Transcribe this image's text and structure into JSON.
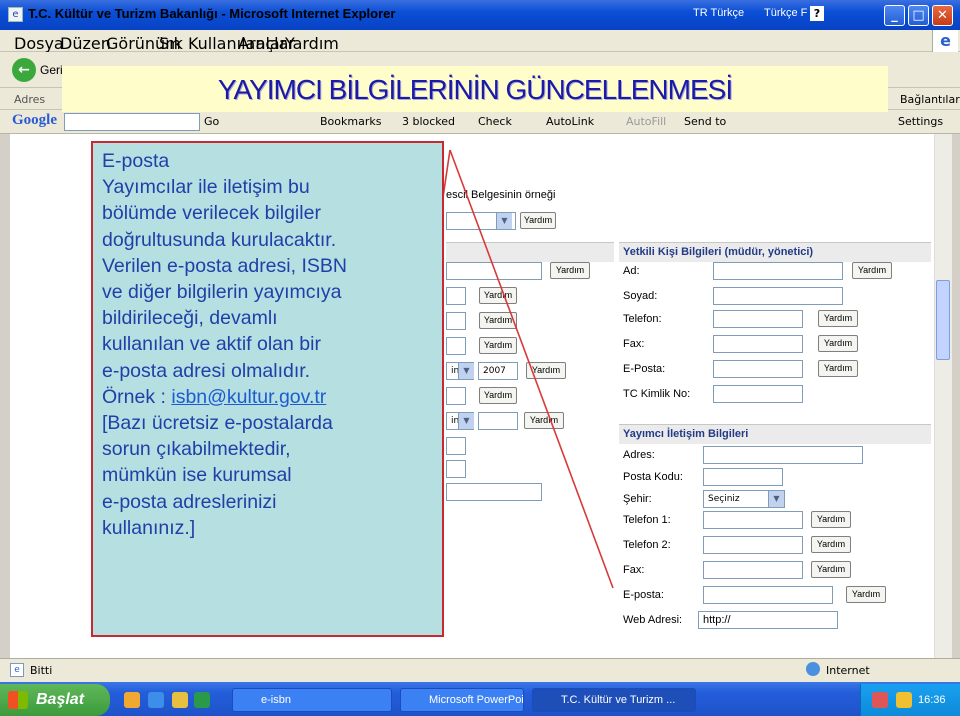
{
  "window": {
    "title": "T.C. Kültür ve Turizm Bakanlığı - Microsoft Internet Explorer",
    "lang1": "TR Türkçe",
    "lang2": "Türkçe F"
  },
  "menu": [
    "Dosya",
    "Düzen",
    "Görünüm",
    "Sık Kullanılanlar",
    "Araçlar",
    "Yardım"
  ],
  "toolbar": {
    "back": "Geri",
    "address_label": "Adres",
    "links_label": "Bağlantılar"
  },
  "google_toolbar": {
    "logo": "Google",
    "go": "Go",
    "bookmarks": "Bookmarks",
    "blocked": "3 blocked",
    "check": "Check",
    "autolink": "AutoLink",
    "autofill": "AutoFill",
    "sendto": "Send to",
    "settings": "Settings"
  },
  "slide": {
    "title": "YAYIMCI BİLGİLERİNİN GÜNCELLENMESİ",
    "lines": [
      "E-posta",
      "Yayımcılar ile iletişim bu",
      "bölümde verilecek bilgiler",
      "doğrultusunda kurulacaktır.",
      "Verilen e-posta adresi, ISBN",
      "ve diğer bilgilerin yayımcıya",
      "bildirileceği, devamlı",
      "kullanılan ve aktif olan bir",
      "e-posta adresi olmalıdır.",
      "Örnek : ",
      "[Bazı ücretsiz e-postalarda",
      "sorun çıkabilmektedir,",
      "mümkün ise kurumsal",
      "e-posta adreslerinizi",
      "kullanınız.]"
    ],
    "example_email": "isbn@kultur.gov.tr"
  },
  "form": {
    "tescil_label": "escil Belgesinin örneği",
    "yardim": "Yardım",
    "year_value": "2007",
    "niz": "iniz",
    "yetkili_header": "Yetkili Kişi Bilgileri (müdür, yönetici)",
    "yetkili_fields": [
      "Ad:",
      "Soyad:",
      "Telefon:",
      "Fax:",
      "E-Posta:",
      "TC Kimlik No:"
    ],
    "iletisim_header": "Yayımcı İletişim Bilgileri",
    "iletisim_fields": [
      "Adres:",
      "Posta Kodu:",
      "Şehir:",
      "Telefon 1:",
      "Telefon 2:",
      "Fax:",
      "E-posta:",
      "Web Adresi:"
    ],
    "city_select": "Seçiniz",
    "web_value": "http://"
  },
  "status": {
    "text": "Bitti",
    "zone": "Internet"
  },
  "taskbar": {
    "start": "Başlat",
    "tasks": [
      "e-isbn",
      "Microsoft PowerPoint ...",
      "T.C. Kültür ve Turizm ..."
    ],
    "clock": "16:36"
  }
}
